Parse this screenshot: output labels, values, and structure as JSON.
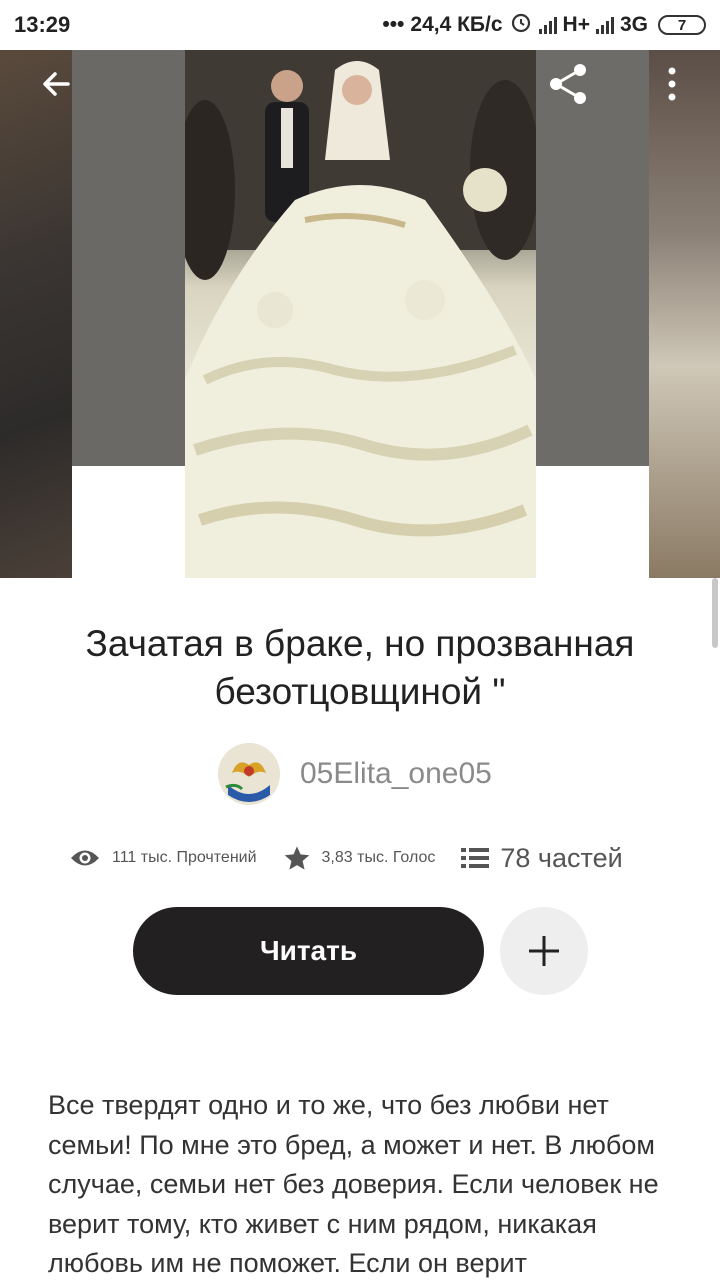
{
  "status_bar": {
    "time": "13:29",
    "network_speed": "24,4 КБ/с",
    "network_type_1": "H+",
    "network_type_2": "3G",
    "battery": "7",
    "icons": [
      "alarm-icon",
      "signal-icon",
      "battery-icon"
    ]
  },
  "header": {
    "back_icon": "arrow-left-icon",
    "share_icon": "share-icon",
    "more_icon": "more-vertical-icon"
  },
  "story": {
    "title": "Зачатая в браке, но прозванная безотцовщиной \"",
    "author": "05Elita_one05",
    "reads": "111 тыс. Прочтений",
    "votes": "3,83 тыс. Голос",
    "parts": "78 частей",
    "read_button": "Читать",
    "description": "Все твердят одно и то же, что без любви нет семьи! По мне это бред, а может и нет. В любом случае, семьи нет без доверия. Если человек не верит тому, кто живет с ним рядом, никакая любовь им не поможет. Если он верит"
  },
  "colors": {
    "primary_button": "#222020",
    "add_button_bg": "#efeeee",
    "muted_text": "#8a8a8a"
  }
}
